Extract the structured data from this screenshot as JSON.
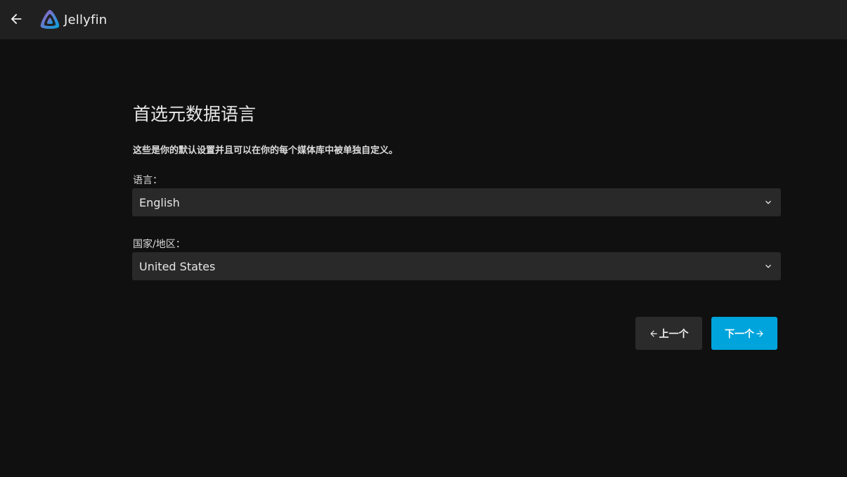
{
  "header": {
    "app_name": "Jellyfin",
    "back_icon": "arrow-left-icon",
    "logo_icon": "jellyfin-logo-icon"
  },
  "page": {
    "title": "首选元数据语言",
    "description": "这些是你的默认设置并且可以在你的每个媒体库中被单独自定义。"
  },
  "form": {
    "language_label": "语言：",
    "language_value": "English",
    "country_label": "国家/地区：",
    "country_value": "United States"
  },
  "buttons": {
    "prev_label": "上一个",
    "next_label": "下一个"
  },
  "colors": {
    "background": "#101010",
    "header": "#202020",
    "select_bg": "#292929",
    "accent": "#00a4dc"
  }
}
